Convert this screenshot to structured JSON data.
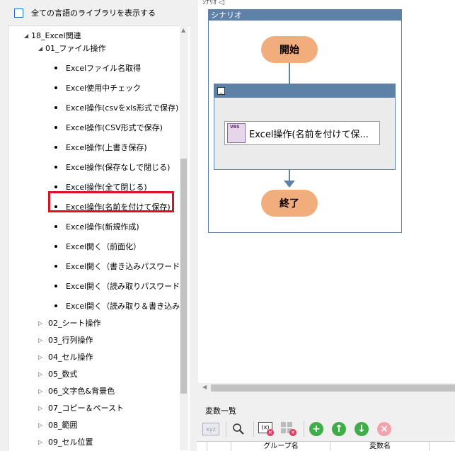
{
  "left_panel": {
    "show_all_label": "全ての言語のライブラリを表示する",
    "tree": {
      "root": {
        "label": "18_Excel関連",
        "expander": "◢"
      },
      "folder_open": {
        "label": "01_ファイル操作",
        "expander": "◢"
      },
      "items": [
        "Excelファイル名取得",
        "Excel使用中チェック",
        "Excel操作(csvをxls形式で保存)",
        "Excel操作(CSV形式で保存)",
        "Excel操作(上書き保存)",
        "Excel操作(保存なしで閉じる)",
        "Excel操作(全て閉じる)",
        "Excel操作(名前を付けて保存)",
        "Excel操作(新規作成)",
        "Excel開く（前面化）",
        "Excel開く（書き込みパスワード付",
        "Excel開く（読み取りパスワード付",
        "Excel開く（読み取り＆書き込み"
      ],
      "highlighted_index": 7,
      "folders": [
        "02_シート操作",
        "03_行列操作",
        "04_セル操作",
        "05_数式",
        "06_文字色&背景色",
        "07_コピー＆ペースト",
        "08_範囲",
        "09_セル位置"
      ],
      "collapsed_expander": "▷"
    }
  },
  "canvas": {
    "tab_hint": "ｼﾅﾘｵ   ◁",
    "scenario_title": "シナリオ",
    "start_label": "開始",
    "end_label": "終了",
    "group_minimize": "_",
    "action_label": "Excel操作(名前を付けて保...",
    "action_icon_text": "VBS"
  },
  "variables": {
    "title": "変数一覧",
    "toolbar": [
      {
        "name": "xyz-icon",
        "glyph": "xyz"
      },
      {
        "name": "search-icon",
        "glyph": "🔍"
      },
      {
        "name": "variable-delete-icon",
        "glyph": "(x)"
      },
      {
        "name": "grid-delete-icon",
        "glyph": "▦"
      },
      {
        "name": "add-icon",
        "glyph": "+"
      },
      {
        "name": "move-up-icon",
        "glyph": "↑"
      },
      {
        "name": "move-down-icon",
        "glyph": "↓"
      },
      {
        "name": "remove-icon",
        "glyph": "×"
      }
    ],
    "columns": [
      "グループ名",
      "変数名"
    ]
  },
  "colors": {
    "scenario_blue": "#5e81a8",
    "pill_orange": "#f2ad7d",
    "highlight_red": "#e0101e",
    "add_green": "#3fae49",
    "remove_pink": "#f4a3ad"
  }
}
